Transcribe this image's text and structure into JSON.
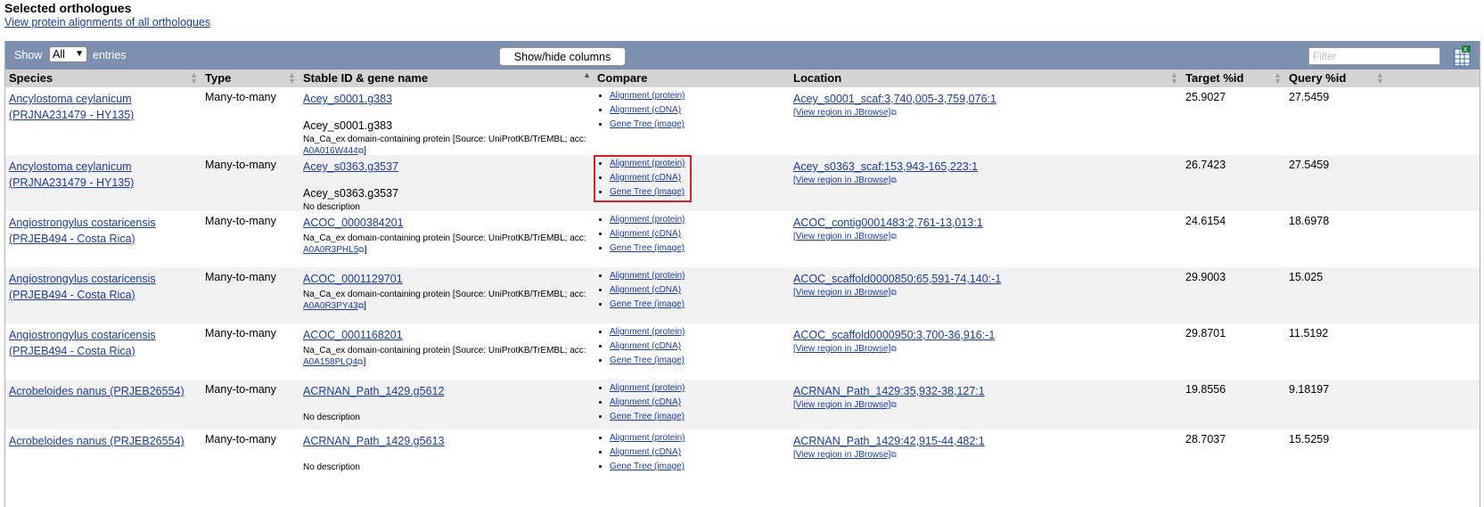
{
  "heading": "Selected orthologues",
  "view_link": "View protein alignments of all orthologues",
  "toolbar": {
    "show_label": "Show",
    "show_value": "All",
    "entries_label": "entries",
    "showhide_label": "Show/hide columns",
    "filter_placeholder": "Filter"
  },
  "columns": {
    "species": "Species",
    "type": "Type",
    "stable": "Stable ID & gene name",
    "compare": "Compare",
    "location": "Location",
    "target": "Target %id",
    "query": "Query %id"
  },
  "compare_labels": [
    "Alignment (protein)",
    "Alignment (cDNA)",
    "Gene Tree (image)"
  ],
  "jbrowse_label": "[View region in JBrowse]",
  "rows": [
    {
      "species": "Ancylostoma ceylanicum (PRJNA231479 - HY135)",
      "type": "Many-to-many",
      "gene_id": "Acey_s0001.g383",
      "gene_name": "Acey_s0001.g383",
      "description": "Na_Ca_ex domain-containing protein [Source: UniProtKB/TrEMBL; acc:",
      "acc": "A0A016W444",
      "location": "Acey_s0001_scaf:3,740,005-3,759,076:1",
      "target": "25.9027",
      "query": "27.5459"
    },
    {
      "species": "Ancylostoma ceylanicum (PRJNA231479 - HY135)",
      "type": "Many-to-many",
      "gene_id": "Acey_s0363.g3537",
      "gene_name": "Acey_s0363.g3537",
      "description": "No description",
      "acc": "",
      "location": "Acey_s0363_scaf:153,943-165,223:1",
      "target": "26.7423",
      "query": "27.5459"
    },
    {
      "species": "Angiostrongylus costaricensis (PRJEB494 - Costa Rica)",
      "type": "Many-to-many",
      "gene_id": "ACOC_0000384201",
      "gene_name": "",
      "description": "Na_Ca_ex domain-containing protein [Source: UniProtKB/TrEMBL; acc:",
      "acc": "A0A0R3PHL5",
      "location": "ACOC_contig0001483:2,761-13,013:1",
      "target": "24.6154",
      "query": "18.6978"
    },
    {
      "species": "Angiostrongylus costaricensis (PRJEB494 - Costa Rica)",
      "type": "Many-to-many",
      "gene_id": "ACOC_0001129701",
      "gene_name": "",
      "description": "Na_Ca_ex domain-containing protein [Source: UniProtKB/TrEMBL; acc:",
      "acc": "A0A0R3PY43",
      "location": "ACOC_scaffold0000850:65,591-74,140:-1",
      "target": "29.9003",
      "query": "15.025"
    },
    {
      "species": "Angiostrongylus costaricensis (PRJEB494 - Costa Rica)",
      "type": "Many-to-many",
      "gene_id": "ACOC_0001168201",
      "gene_name": "",
      "description": "Na_Ca_ex domain-containing protein [Source: UniProtKB/TrEMBL; acc:",
      "acc": "A0A158PLQ4",
      "location": "ACOC_scaffold0000950:3,700-36,916:-1",
      "target": "29.8701",
      "query": "11.5192"
    },
    {
      "species": "Acrobeloides nanus (PRJEB26554)",
      "type": "Many-to-many",
      "gene_id": "ACRNAN_Path_1429.g5612",
      "gene_name": "",
      "description": "No description",
      "acc": "",
      "location": "ACRNAN_Path_1429:35,932-38,127:1",
      "target": "19.8556",
      "query": "9.18197"
    },
    {
      "species": "Acrobeloides nanus (PRJEB26554)",
      "type": "Many-to-many",
      "gene_id": "ACRNAN_Path_1429.g5613",
      "gene_name": "",
      "description": "No description",
      "acc": "",
      "location": "ACRNAN_Path_1429:42,915-44,482:1",
      "target": "28.7037",
      "query": "15.5259"
    }
  ]
}
